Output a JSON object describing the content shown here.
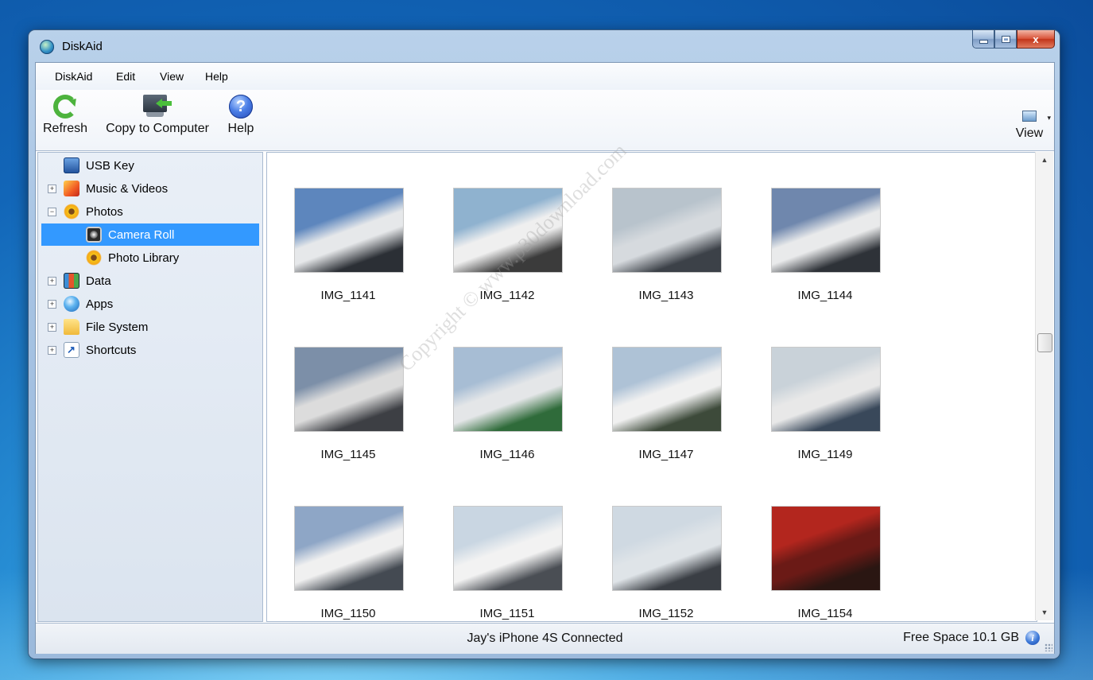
{
  "window": {
    "title": "DiskAid",
    "min_glyph": "",
    "max_glyph": "",
    "close_glyph": "x"
  },
  "menu": {
    "items": [
      "DiskAid",
      "Edit",
      "View",
      "Help"
    ]
  },
  "toolbar": {
    "refresh_label": "Refresh",
    "copy_label": "Copy to Computer",
    "help_label": "Help",
    "help_glyph": "?",
    "view_label": "View",
    "view_caret": "▾"
  },
  "tree": {
    "items": [
      {
        "label": "USB Key",
        "icon": "usb-key-icon"
      },
      {
        "label": "Music & Videos",
        "icon": "music-icon"
      },
      {
        "label": "Photos",
        "icon": "photos-icon"
      },
      {
        "label": "Camera Roll",
        "icon": "camera-icon"
      },
      {
        "label": "Photo Library",
        "icon": "photos-icon"
      },
      {
        "label": "Data",
        "icon": "data-icon"
      },
      {
        "label": "Apps",
        "icon": "apps-icon"
      },
      {
        "label": "File System",
        "icon": "folder-icon"
      },
      {
        "label": "Shortcuts",
        "icon": "shortcut-icon"
      }
    ],
    "selected": "Camera Roll",
    "expander_plus": "+",
    "expander_minus": "−"
  },
  "photos": {
    "items": [
      {
        "name": "IMG_1141",
        "colors": [
          "#5d86bd",
          "#e6e8ea",
          "#2b2f35"
        ]
      },
      {
        "name": "IMG_1142",
        "colors": [
          "#8fb2cf",
          "#efefef",
          "#3b3b3b"
        ]
      },
      {
        "name": "IMG_1143",
        "colors": [
          "#b8c3cc",
          "#d6dade",
          "#3c4148"
        ]
      },
      {
        "name": "IMG_1144",
        "colors": [
          "#6f87ad",
          "#e9eaeb",
          "#2e3238"
        ]
      },
      {
        "name": "IMG_1145",
        "colors": [
          "#7c8fa8",
          "#dcdcdc",
          "#3d3f44"
        ]
      },
      {
        "name": "IMG_1146",
        "colors": [
          "#a7bdd4",
          "#e4e6e8",
          "#2f6b3a"
        ]
      },
      {
        "name": "IMG_1147",
        "colors": [
          "#aec2d6",
          "#f0f0f0",
          "#3d4a3a"
        ]
      },
      {
        "name": "IMG_1149",
        "colors": [
          "#c9d2d9",
          "#e8e8e8",
          "#39485a"
        ]
      },
      {
        "name": "IMG_1150",
        "colors": [
          "#8ea6c6",
          "#f0f0f0",
          "#444a52"
        ]
      },
      {
        "name": "IMG_1151",
        "colors": [
          "#c9d6e2",
          "#f2f2f2",
          "#4a4e54"
        ]
      },
      {
        "name": "IMG_1152",
        "colors": [
          "#cfd9e2",
          "#dfe4e8",
          "#3a3e44"
        ]
      },
      {
        "name": "IMG_1154",
        "colors": [
          "#b3261e",
          "#6b1a16",
          "#2a1612"
        ]
      }
    ],
    "watermark": "Copyright © www.p30download.com"
  },
  "scrollbar": {
    "up": "▲",
    "down": "▼"
  },
  "status": {
    "device": "Jay's iPhone 4S Connected",
    "free_space": "Free Space 10.1 GB",
    "info_glyph": "i"
  }
}
